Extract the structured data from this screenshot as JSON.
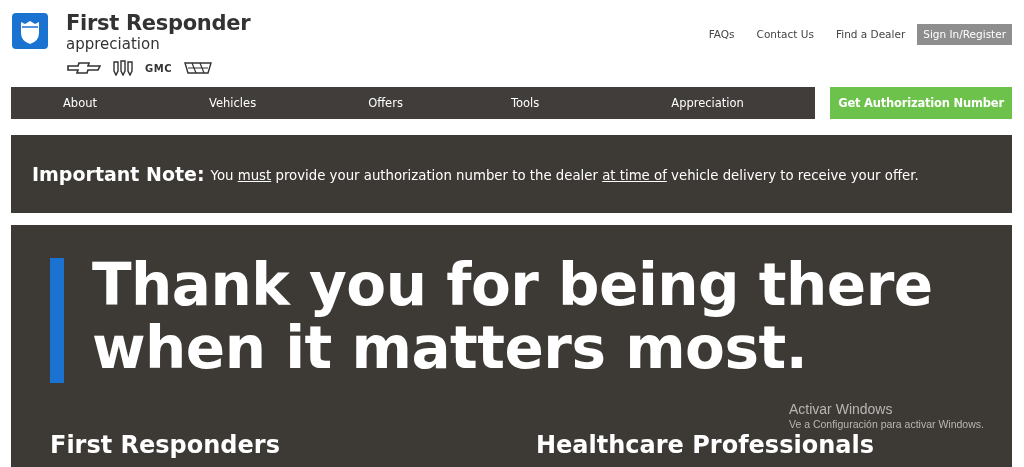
{
  "header": {
    "title": "First Responder",
    "subtitle": "appreciation",
    "brands": [
      {
        "kind": "bowtie"
      },
      {
        "kind": "shields"
      },
      {
        "kind": "wordmark",
        "text": "GMC"
      },
      {
        "kind": "crest"
      }
    ],
    "links": [
      {
        "label": "FAQs",
        "kind": "link"
      },
      {
        "label": "Contact Us",
        "kind": "link"
      },
      {
        "label": "Find a Dealer",
        "kind": "link"
      },
      {
        "label": "Sign In/Register",
        "kind": "button"
      }
    ]
  },
  "nav": {
    "items": [
      "About",
      "Vehicles",
      "Offers",
      "Tools",
      "Appreciation"
    ],
    "cta": "Get Authorization Number"
  },
  "note": {
    "title": "Important Note:",
    "segments": [
      {
        "text": "You ",
        "underline": false
      },
      {
        "text": "must",
        "underline": true
      },
      {
        "text": " provide your authorization number to the dealer ",
        "underline": false
      },
      {
        "text": "at time of",
        "underline": true
      },
      {
        "text": " vehicle delivery to receive your offer.",
        "underline": false
      }
    ]
  },
  "hero": {
    "headline": [
      "Thank you for being there",
      "when it matters most."
    ],
    "columns": [
      "First Responders",
      "Healthcare Professionals"
    ]
  },
  "os_overlay": {
    "title": "Activar Windows",
    "text": "Ve a Configuración para activar Windows."
  }
}
